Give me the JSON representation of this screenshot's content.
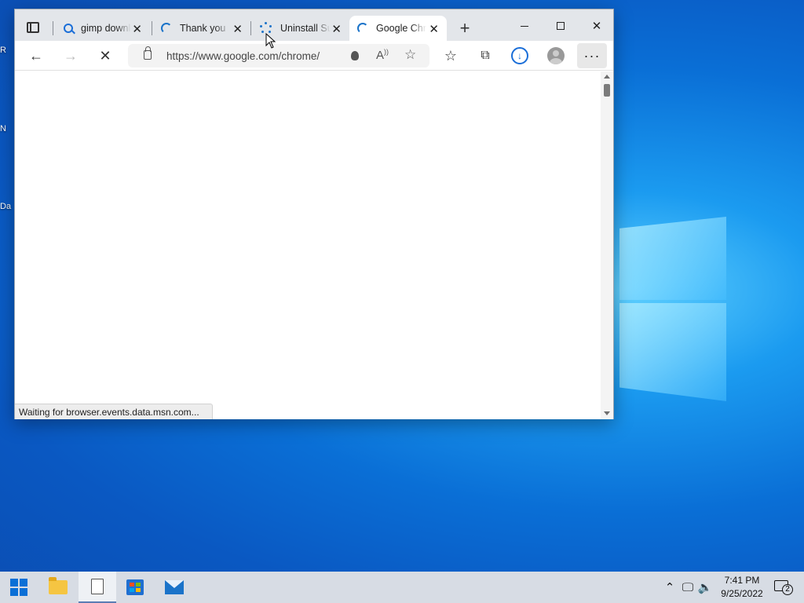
{
  "desktop": {
    "partial_labels": [
      "R",
      "N",
      "Da"
    ]
  },
  "browser": {
    "tabs": [
      {
        "title": "gimp downloads",
        "favicon": "search-icon"
      },
      {
        "title": "Thank you",
        "favicon": "loading-spinner-icon"
      },
      {
        "title": "Uninstall Sub",
        "favicon": "loading-dots-icon"
      },
      {
        "title": "Google Chrome",
        "favicon": "loading-spinner-icon",
        "active": true
      }
    ],
    "new_tab_label": "+",
    "address": {
      "url": "https://www.google.com/chrome/"
    },
    "status_text": "Waiting for browser.events.data.msn.com...",
    "more_label": "···"
  },
  "taskbar": {
    "time": "7:41 PM",
    "date": "9/25/2022",
    "notification_count": "2"
  },
  "colors": {
    "accent": "#1a6ed8",
    "taskbar": "#d7dce4"
  }
}
